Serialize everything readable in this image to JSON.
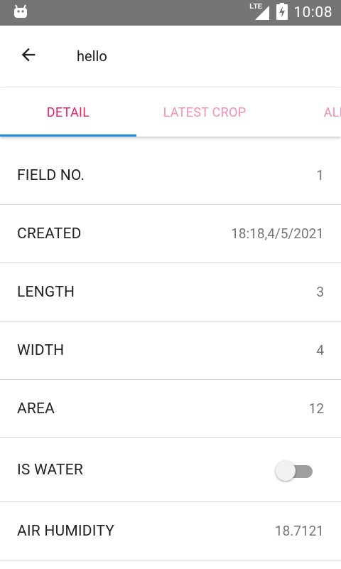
{
  "status_bar": {
    "network": "LTE",
    "time": "10:08",
    "icons": [
      "android-icon",
      "lte-signal-icon",
      "battery-charging-icon"
    ]
  },
  "app_bar": {
    "title": "hello",
    "back_icon": "arrow-back-icon"
  },
  "tabs": [
    {
      "label": "DETAIL",
      "active": true
    },
    {
      "label": "LATEST CROP",
      "active": false
    },
    {
      "label": "ALL C",
      "active": false
    }
  ],
  "details": [
    {
      "label": "FIELD NO.",
      "value": "1"
    },
    {
      "label": "CREATED",
      "value": "18:18,4/5/2021"
    },
    {
      "label": "LENGTH",
      "value": "3"
    },
    {
      "label": "WIDTH",
      "value": "4"
    },
    {
      "label": "AREA",
      "value": "12"
    },
    {
      "label": "IS WATER",
      "toggle_on": false
    },
    {
      "label": "AIR HUMIDITY",
      "value": "18.7121"
    }
  ],
  "colors": {
    "status_bar": "#757575",
    "tab_active": "#e91e63",
    "tab_inactive": "#f48fb1",
    "tab_indicator": "#1e88e5"
  }
}
